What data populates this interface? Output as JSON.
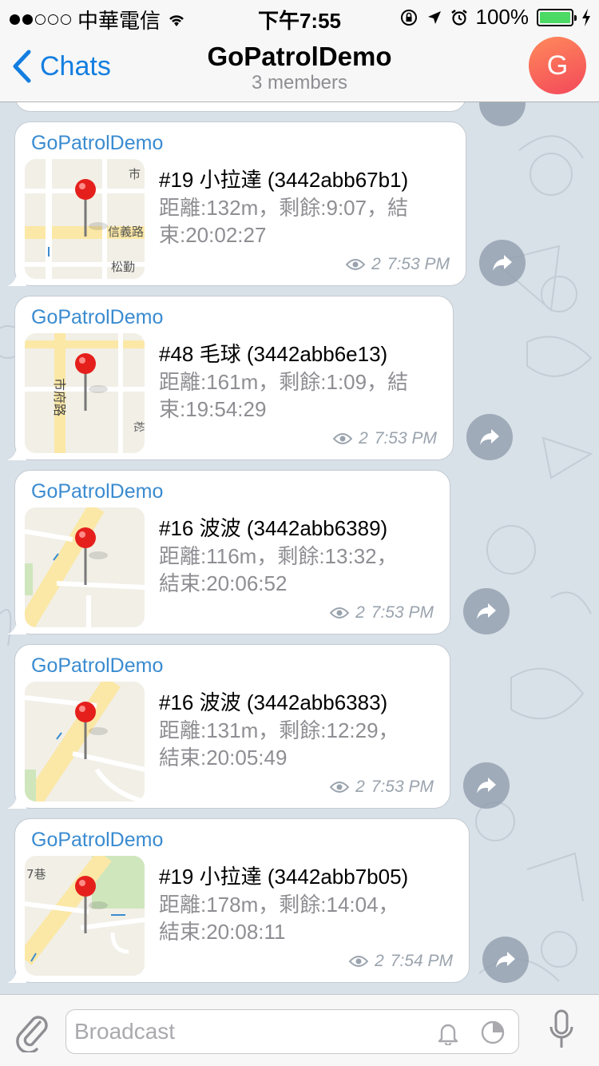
{
  "status_bar": {
    "carrier": "中華電信",
    "time": "下午7:55",
    "battery": "100%"
  },
  "nav": {
    "back_label": "Chats",
    "title": "GoPatrolDemo",
    "subtitle": "3 members",
    "avatar_letter": "G"
  },
  "messages": [
    {
      "sender": "GoPatrolDemo",
      "title": "#19 小拉達 (3442abb67b1)",
      "detail": "距離:132m，剩餘:9:07，結\n束:20:02:27",
      "views": "2",
      "time": "7:53 PM",
      "map_labels": [
        "信義路五",
        "松勤",
        "市"
      ]
    },
    {
      "sender": "GoPatrolDemo",
      "title": "#48 毛球 (3442abb6e13)",
      "detail": "距離:161m，剩餘:1:09，結\n束:19:54:29",
      "views": "2",
      "time": "7:53 PM",
      "map_labels": [
        "市府路",
        "松"
      ]
    },
    {
      "sender": "GoPatrolDemo",
      "title": "#16 波波 (3442abb6389)",
      "detail": "距離:116m，剩餘:13:32，\n結束:20:06:52",
      "views": "2",
      "time": "7:53 PM",
      "map_labels": []
    },
    {
      "sender": "GoPatrolDemo",
      "title": "#16 波波 (3442abb6383)",
      "detail": "距離:131m，剩餘:12:29，\n結束:20:05:49",
      "views": "2",
      "time": "7:53 PM",
      "map_labels": []
    },
    {
      "sender": "GoPatrolDemo",
      "title": "#19 小拉達 (3442abb7b05)",
      "detail": "距離:178m，剩餘:14:04，\n結束:20:08:11",
      "views": "2",
      "time": "7:54 PM",
      "map_labels": [
        "7巷"
      ]
    }
  ],
  "input": {
    "placeholder": "Broadcast"
  },
  "colors": {
    "accent": "#137ee0",
    "sender": "#3a8bd0",
    "avatar_from": "#ff8a5b",
    "avatar_to": "#f3485a",
    "battery": "#4cd964"
  },
  "icons": [
    "signal-dots-icon",
    "wifi-icon",
    "rotation-lock-icon",
    "location-arrow-icon",
    "alarm-icon",
    "battery-icon",
    "charging-icon",
    "chevron-left-icon",
    "eye-icon",
    "share-arrow-icon",
    "map-pin-icon",
    "paperclip-icon",
    "bell-icon",
    "moon-icon",
    "microphone-icon"
  ]
}
